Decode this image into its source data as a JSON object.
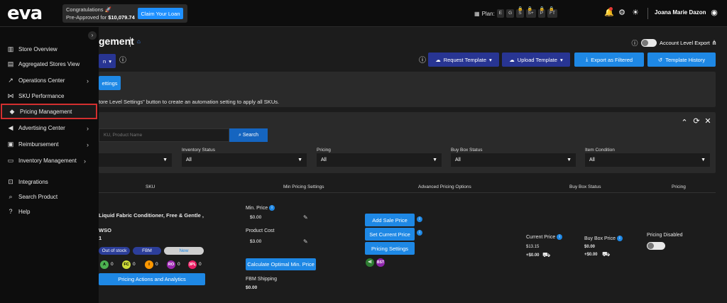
{
  "header": {
    "logo": "eva",
    "promo_line1": "Congratulations 🚀",
    "promo_line2_prefix": "Pre-Approved for",
    "promo_amount": "$10,079.74",
    "claim_label": "Claim Your Loan",
    "plan_label": "Plan:",
    "plan_chips": [
      "E",
      "G",
      "S",
      "S+",
      "P",
      "FT"
    ],
    "user_name": "Joana Marie Dazon"
  },
  "sidebar": {
    "items": [
      {
        "label": "Store Overview",
        "icon": "bar-chart-icon"
      },
      {
        "label": "Aggregated Stores View",
        "icon": "stacked-bar-icon"
      },
      {
        "label": "Operations Center",
        "icon": "trend-icon"
      },
      {
        "label": "SKU Performance",
        "icon": "sku-icon"
      },
      {
        "label": "Pricing Management",
        "icon": "tag-icon"
      },
      {
        "label": "Advertising Center",
        "icon": "megaphone-icon"
      },
      {
        "label": "Reimbursement",
        "icon": "reimburse-icon"
      },
      {
        "label": "Inventory Management",
        "icon": "inventory-icon"
      },
      {
        "label": "Integrations",
        "icon": "integrations-icon"
      },
      {
        "label": "Search Product",
        "icon": "search-icon"
      },
      {
        "label": "Help",
        "icon": "help-icon"
      }
    ]
  },
  "main": {
    "title": "gement",
    "store_select": "n",
    "account_export_label": "Account Level Export",
    "request_template": "Request Template",
    "upload_template": "Upload Template",
    "export_filtered": "Export as Filtered",
    "template_history": "Template History",
    "settings_button": "ettings",
    "note": "tore Level Settings\" button to create an automation setting to apply all SKUs.",
    "search_placeholder": "KU, Product Name",
    "search_button": "Search",
    "filters": [
      {
        "label": "",
        "value": ""
      },
      {
        "label": "Inventory Status",
        "value": "All"
      },
      {
        "label": "Pricing",
        "value": "All"
      },
      {
        "label": "Buy Box Status",
        "value": "All"
      },
      {
        "label": "Item Condition",
        "value": "All"
      }
    ],
    "columns": [
      "SKU",
      "Min Pricing Settings",
      "Advanced Pricing Options",
      "Buy Box Status",
      "Pricing"
    ]
  },
  "row": {
    "product_name": "Liquid Fabric Conditioner, Free & Gentle ,",
    "sku_code": "WSO",
    "sku_sub": "1",
    "stock_status": "Out of stock",
    "fulfillment": "FBM",
    "condition": "New",
    "counters": [
      {
        "label": "A",
        "value": "0",
        "color": "#4caf50"
      },
      {
        "label": "FC",
        "value": "0",
        "color": "#cddc39"
      },
      {
        "label": "I",
        "value": "0",
        "color": "#ff9800"
      },
      {
        "label": "RO",
        "value": "0",
        "color": "#9c27b0"
      },
      {
        "label": "3PL",
        "value": "0",
        "color": "#e91e63"
      }
    ],
    "pricing_actions": "Pricing Actions and Analytics",
    "min_price_label": "Min. Price",
    "min_price_value": "$0.00",
    "product_cost_label": "Product Cost",
    "product_cost_value": "$3.00",
    "calc_button": "Calculate Optimal Min. Price",
    "fbm_shipping_label": "FBM Shipping",
    "fbm_shipping_value": "$0.00",
    "add_sale_price": "Add Sale Price",
    "set_current_price": "Set Current Price",
    "pricing_settings": "Pricing Settings",
    "bst_badge": "BST",
    "current_price_label": "Current Price",
    "current_price_value": "$13.15",
    "current_price_ship": "+$0.00",
    "buy_box_label": "Buy Box Price",
    "buy_box_value": "$0.00",
    "buy_box_ship": "+$0.00",
    "pricing_status": "Pricing Disabled"
  },
  "colors": {
    "accent": "#1e88e5",
    "dark_button": "#283593",
    "active_outline": "#d32f2f"
  }
}
